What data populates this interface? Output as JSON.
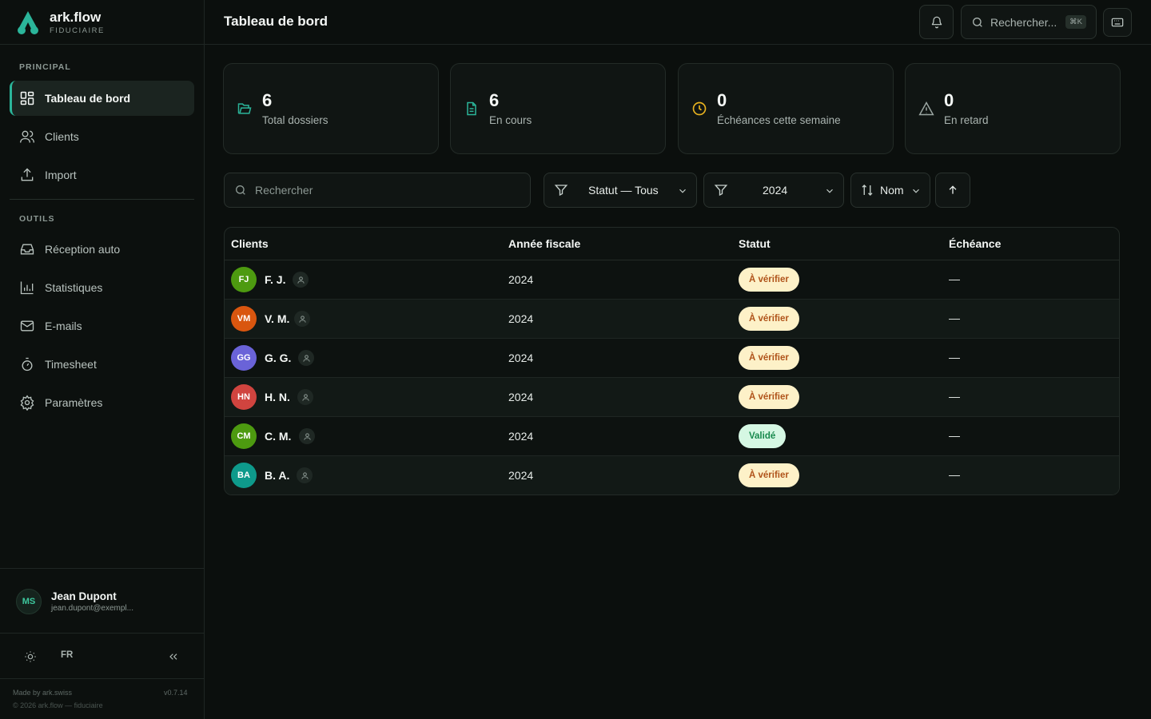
{
  "brand": {
    "name": "ark.flow",
    "subtitle": "FIDUCIAIRE"
  },
  "sidebar": {
    "sections": [
      {
        "title": "PRINCIPAL"
      },
      {
        "title": "OUTILS"
      }
    ],
    "items": [
      {
        "label": "Tableau de bord",
        "icon": "dashboard-icon",
        "active": true
      },
      {
        "label": "Clients",
        "icon": "users-icon"
      },
      {
        "label": "Import",
        "icon": "upload-icon"
      },
      {
        "label": "Réception auto",
        "icon": "inbox-icon"
      },
      {
        "label": "Statistiques",
        "icon": "bar-chart-icon"
      },
      {
        "label": "E-mails",
        "icon": "mail-icon"
      },
      {
        "label": "Timesheet",
        "icon": "timer-icon"
      },
      {
        "label": "Paramètres",
        "icon": "gear-icon"
      }
    ]
  },
  "user": {
    "initials": "MS",
    "name": "Jean Dupont",
    "email": "jean.dupont@exempl..."
  },
  "tools": {
    "language": "FR"
  },
  "footer": {
    "made_by": "Made by ark.swiss",
    "copyright": "© 2026 ark.flow — fiduciaire",
    "version": "v0.7.14"
  },
  "header": {
    "title": "Tableau de bord",
    "search_placeholder": "Rechercher...",
    "shortcut": "⌘K"
  },
  "stats": [
    {
      "value": "6",
      "label": "Total dossiers",
      "icon": "folder-open-icon",
      "color": "#2bb59a"
    },
    {
      "value": "6",
      "label": "En cours",
      "icon": "file-text-icon",
      "color": "#2bb59a"
    },
    {
      "value": "0",
      "label": "Échéances cette semaine",
      "icon": "clock-icon",
      "color": "#e8b21f"
    },
    {
      "value": "0",
      "label": "En retard",
      "icon": "alert-triangle-icon",
      "color": "#9aa5a1"
    }
  ],
  "filters": {
    "search_placeholder": "Rechercher",
    "status": "Statut — Tous",
    "year": "2024",
    "sort": "Nom"
  },
  "table": {
    "columns": [
      "Clients",
      "Année fiscale",
      "Statut",
      "Échéance"
    ],
    "rows": [
      {
        "initials": "FJ",
        "name": "F. J.",
        "avatar_color": "#4d9a10",
        "year": "2024",
        "status": "À vérifier",
        "status_kind": "warn",
        "due": "—"
      },
      {
        "initials": "VM",
        "name": "V. M.",
        "avatar_color": "#d9560f",
        "year": "2024",
        "status": "À vérifier",
        "status_kind": "warn",
        "due": "—"
      },
      {
        "initials": "GG",
        "name": "G. G.",
        "avatar_color": "#6a63d8",
        "year": "2024",
        "status": "À vérifier",
        "status_kind": "warn",
        "due": "—"
      },
      {
        "initials": "HN",
        "name": "H. N.",
        "avatar_color": "#d0443f",
        "year": "2024",
        "status": "À vérifier",
        "status_kind": "warn",
        "due": "—"
      },
      {
        "initials": "CM",
        "name": "C. M.",
        "avatar_color": "#4d9a10",
        "year": "2024",
        "status": "Validé",
        "status_kind": "ok",
        "due": "—"
      },
      {
        "initials": "BA",
        "name": "B. A.",
        "avatar_color": "#0e9a8b",
        "year": "2024",
        "status": "À vérifier",
        "status_kind": "warn",
        "due": "—"
      }
    ]
  },
  "colors": {
    "accent": "#2bb59a",
    "warning_bg": "#fdf1c8",
    "warning_text": "#b0531a",
    "success_bg": "#d5f7e3",
    "success_text": "#16894c"
  }
}
